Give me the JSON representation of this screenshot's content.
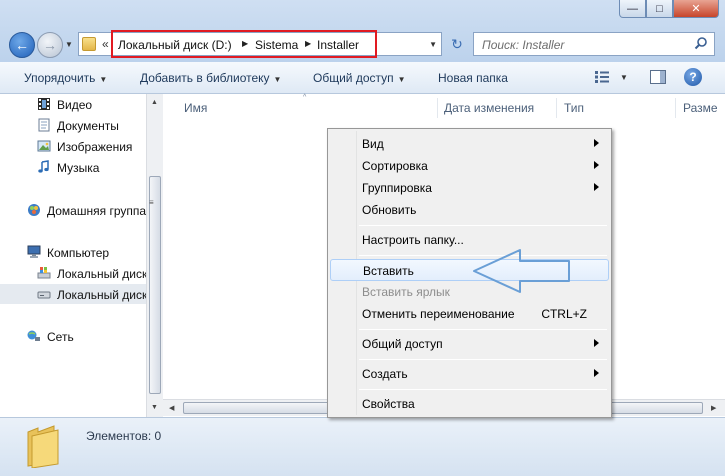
{
  "window": {
    "minimize_glyph": "—",
    "maximize_glyph": "□",
    "close_glyph": "✕"
  },
  "navigation": {
    "back_glyph": "←",
    "forward_glyph": "→",
    "history_dropdown_glyph": "▼"
  },
  "address": {
    "overflow_glyph": "«",
    "crumbs": [
      "Локальный диск (D:)",
      "Sistema",
      "Installer"
    ],
    "separator_glyph": "▶",
    "dropdown_glyph": "▼",
    "highlight_color": "#e11a22"
  },
  "refresh_glyph": "↻",
  "search": {
    "placeholder": "Поиск: Installer"
  },
  "toolbar": {
    "organize": "Упорядочить",
    "add_to_library": "Добавить в библиотеку",
    "share": "Общий доступ",
    "new_folder": "Новая папка",
    "dropdown_glyph": "▼",
    "help_glyph": "?"
  },
  "nav_pane": {
    "items": [
      {
        "label": "Видео",
        "icon": "video-icon"
      },
      {
        "label": "Документы",
        "icon": "documents-icon"
      },
      {
        "label": "Изображения",
        "icon": "pictures-icon"
      },
      {
        "label": "Музыка",
        "icon": "music-icon"
      },
      {
        "label": "Домашняя группа",
        "icon": "homegroup-icon"
      },
      {
        "label": "Компьютер",
        "icon": "computer-icon"
      },
      {
        "label": "Локальный диск",
        "icon": "system-drive-icon"
      },
      {
        "label": "Локальный диск",
        "icon": "drive-icon",
        "selected": true
      },
      {
        "label": "Сеть",
        "icon": "network-icon"
      }
    ],
    "grip_glyph": "≡"
  },
  "columns": {
    "name": "Имя",
    "date_modified": "Дата изменения",
    "type": "Тип",
    "size": "Разме"
  },
  "scroll_glyphs": {
    "up": "▲",
    "down": "▼",
    "left": "◀",
    "right": "▶",
    "sort": "^"
  },
  "status": {
    "items_count": "Элементов: 0"
  },
  "context_menu": {
    "view": "Вид",
    "sort": "Сортировка",
    "group": "Группировка",
    "refresh": "Обновить",
    "customize": "Настроить папку...",
    "paste": "Вставить",
    "paste_shortcut": "Вставить ярлык",
    "undo_rename": "Отменить переименование",
    "undo_shortcut": "CTRL+Z",
    "share": "Общий доступ",
    "new": "Создать",
    "properties": "Свойства"
  },
  "annotation_color": "#6a9fd6"
}
